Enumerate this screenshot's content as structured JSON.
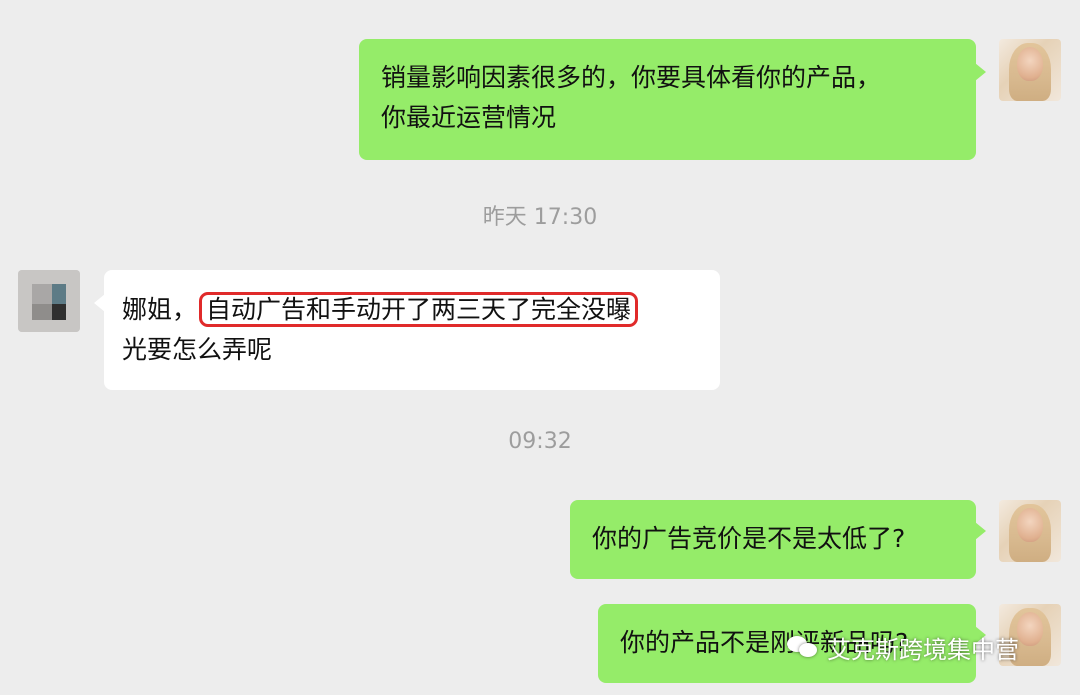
{
  "messages": [
    {
      "side": "right",
      "text_line1": "销量影响因素很多的，你要具体看你的产品，",
      "text_line2": "你最近运营情况"
    },
    {
      "side": "left",
      "prefix": "娜姐，",
      "highlighted": "自动广告和手动开了两三天了完全没曝",
      "continuation": "光要怎么弄呢"
    },
    {
      "side": "right",
      "text": "你的广告竞价是不是太低了?"
    },
    {
      "side": "right",
      "text": "你的产品不是刚评新品吗?"
    }
  ],
  "timestamps": {
    "first": "昨天 17:30",
    "second": "09:32"
  },
  "watermark": {
    "text": "艾克斯跨境集中营",
    "icon": "wechat-icon"
  },
  "colors": {
    "background": "#ededed",
    "outgoing_bubble": "#95ec69",
    "incoming_bubble": "#ffffff",
    "highlight_border": "#e02a2a",
    "timestamp_text": "#9d9d9d"
  }
}
